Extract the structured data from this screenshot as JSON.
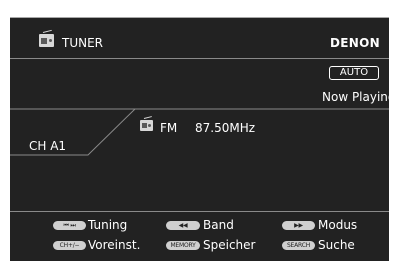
{
  "header": {
    "source_label": "TUNER",
    "brand": "DENON"
  },
  "status": {
    "mode_badge": "AUTO",
    "now_playing": "Now Playing"
  },
  "station": {
    "preset": "CH A1",
    "band": "FM",
    "frequency": "87.50MHz"
  },
  "hints": [
    {
      "keys": "⏮ ⏭",
      "label": "Tuning"
    },
    {
      "keys": "◀◀",
      "label": "Band"
    },
    {
      "keys": "▶▶",
      "label": "Modus"
    },
    {
      "keys": "CH+/−",
      "label": "Voreinst."
    },
    {
      "keys": "MEMORY",
      "label": "Speicher"
    },
    {
      "keys": "SEARCH",
      "label": "Suche"
    }
  ]
}
